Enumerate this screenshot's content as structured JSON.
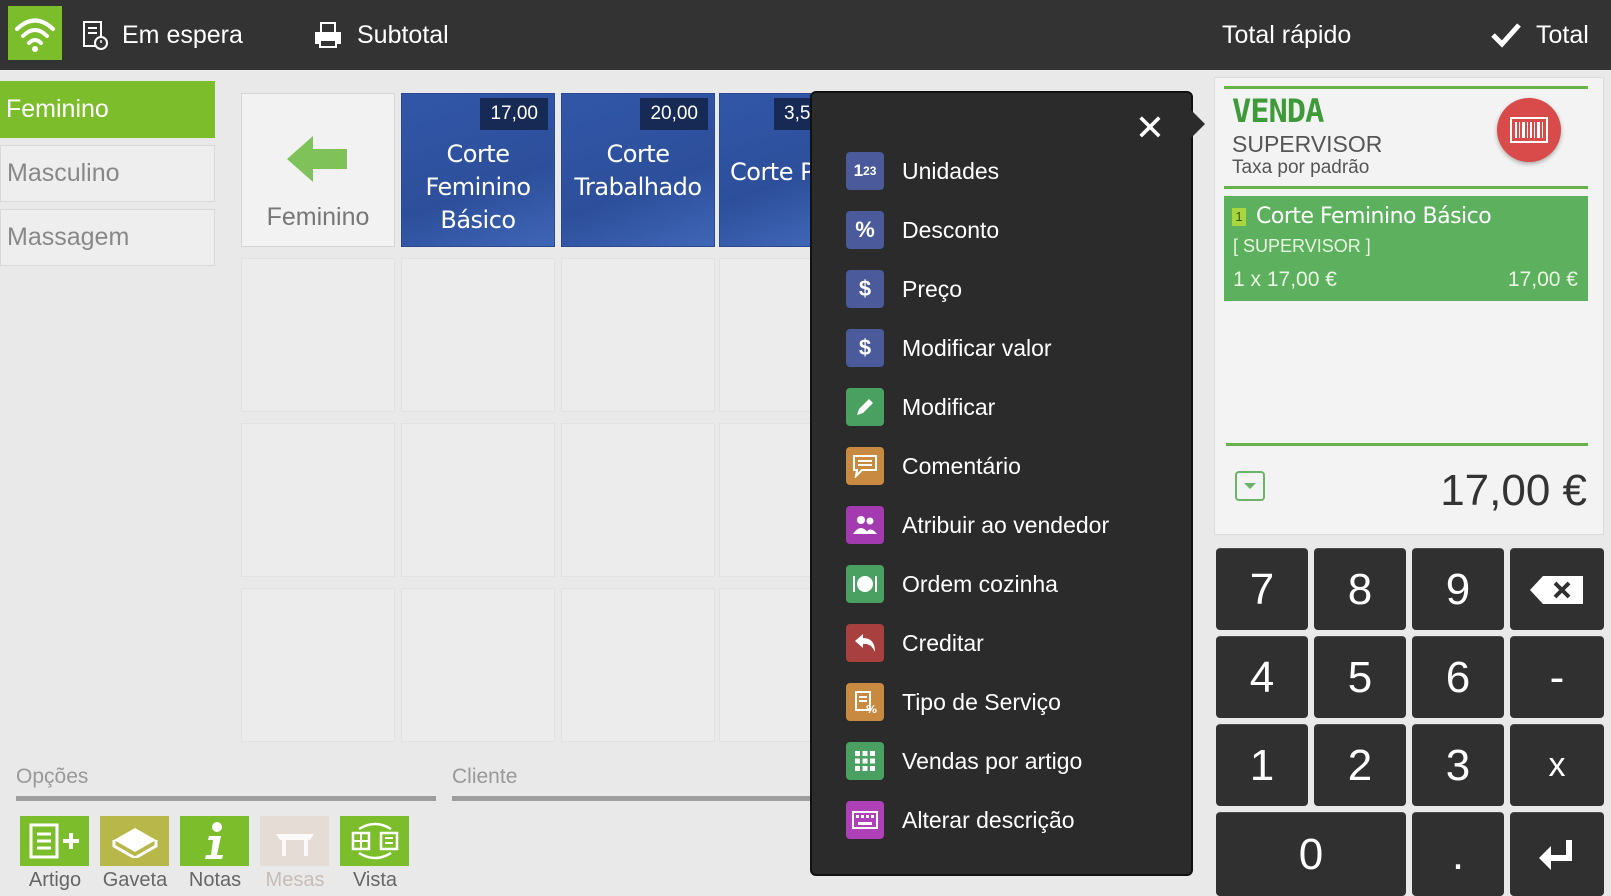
{
  "topbar": {
    "hold_label": "Em espera",
    "subtotal_label": "Subtotal",
    "quick_total_label": "Total rápido",
    "total_label": "Total"
  },
  "categories": [
    {
      "label": "Feminino",
      "active": true
    },
    {
      "label": "Masculino",
      "active": false
    },
    {
      "label": "Massagem",
      "active": false
    }
  ],
  "grid": {
    "back_label": "Feminino",
    "products": [
      {
        "price": "17,00",
        "name_lines": [
          "Corte",
          "Feminino",
          "Básico"
        ]
      },
      {
        "price": "20,00",
        "name_lines": [
          "Corte",
          "Trabalhado"
        ]
      },
      {
        "price": "3,5",
        "name_lines": [
          "Corte Pa"
        ]
      }
    ]
  },
  "options": {
    "section_label": "Opções",
    "client_label": "Cliente",
    "buttons": [
      {
        "label": "Artigo",
        "icon": "article-add-icon",
        "enabled": true
      },
      {
        "label": "Gaveta",
        "icon": "drawer-icon",
        "enabled": true
      },
      {
        "label": "Notas",
        "icon": "info-icon",
        "enabled": true
      },
      {
        "label": "Mesas",
        "icon": "table-icon",
        "enabled": false
      },
      {
        "label": "Vista",
        "icon": "view-switch-icon",
        "enabled": true
      }
    ]
  },
  "menu": {
    "items": [
      {
        "label": "Unidades",
        "icon": "units-icon",
        "color": "#4a5a9a",
        "glyph": "1₂³"
      },
      {
        "label": "Desconto",
        "icon": "percent-icon",
        "color": "#4a5a9a",
        "glyph": "%"
      },
      {
        "label": "Preço",
        "icon": "dollar-icon",
        "color": "#4a5a9a",
        "glyph": "$"
      },
      {
        "label": "Modificar valor",
        "icon": "dollar-icon",
        "color": "#4a5a9a",
        "glyph": "$"
      },
      {
        "label": "Modificar",
        "icon": "pencil-icon",
        "color": "#4aa060",
        "glyph": "✎"
      },
      {
        "label": "Comentário",
        "icon": "comment-icon",
        "color": "#c88a40",
        "glyph": "▤"
      },
      {
        "label": "Atribuir ao vendedor",
        "icon": "users-icon",
        "color": "#a33ab0",
        "glyph": "👥"
      },
      {
        "label": "Ordem cozinha",
        "icon": "kitchen-icon",
        "color": "#4aa060",
        "glyph": "◉"
      },
      {
        "label": "Creditar",
        "icon": "undo-icon",
        "color": "#a84040",
        "glyph": "↶"
      },
      {
        "label": "Tipo de Serviço",
        "icon": "service-type-icon",
        "color": "#c88a40",
        "glyph": "▦"
      },
      {
        "label": "Vendas por artigo",
        "icon": "grid-icon",
        "color": "#4aa060",
        "glyph": "▦"
      },
      {
        "label": "Alterar descrição",
        "icon": "keyboard-icon",
        "color": "#b040b8",
        "glyph": "⌨"
      }
    ]
  },
  "ticket": {
    "type": "VENDA",
    "user": "SUPERVISOR",
    "tax": "Taxa por padrão",
    "lines": [
      {
        "qty_badge": "1",
        "name": "Corte Feminino Básico",
        "seller": "[ SUPERVISOR ]",
        "qty_price": "1 x 17,00 €",
        "amount": "17,00 €"
      }
    ],
    "total": "17,00 €"
  },
  "keypad": {
    "keys": [
      "7",
      "8",
      "9",
      "⌫",
      "4",
      "5",
      "6",
      "-",
      "1",
      "2",
      "3",
      "x",
      "0",
      ".",
      "↵"
    ]
  },
  "colors": {
    "accent_green": "#7cbd2c",
    "topbar": "#333333",
    "product_blue": "#2d4f9b"
  }
}
